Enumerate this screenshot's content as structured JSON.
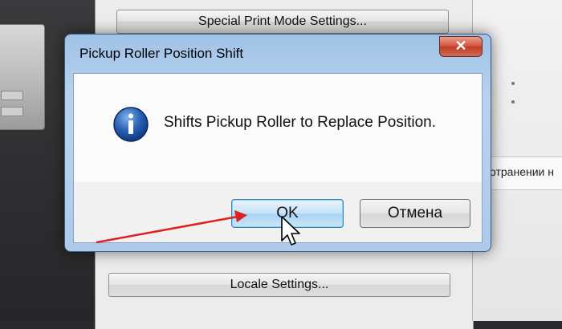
{
  "background": {
    "top_button_label": "Special Print Mode Settings...",
    "bottom_button_label": "Locale Settings...",
    "right_panel_text": "отранении н"
  },
  "dialog": {
    "title": "Pickup Roller Position Shift",
    "close_label": "✕",
    "icon": "info-icon",
    "message": "Shifts Pickup Roller to Replace Position.",
    "ok_label": "OK",
    "cancel_label": "Отмена"
  },
  "annotation": {
    "arrow_color": "#e02020",
    "points_to": "ok-button"
  },
  "colors": {
    "title_bar": "#aecbeb",
    "close_button": "#c13a22",
    "ok_button_highlight": "#a8d4f3"
  }
}
